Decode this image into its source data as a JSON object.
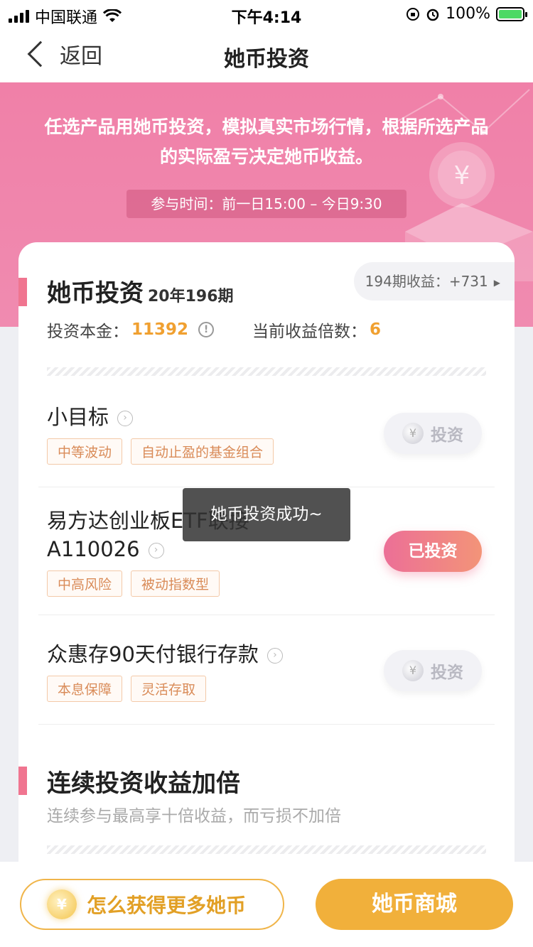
{
  "status_bar": {
    "carrier": "中国联通",
    "time": "下午4:14",
    "battery": "100%"
  },
  "nav": {
    "back_label": "返回",
    "title": "她币投资"
  },
  "banner": {
    "text": "任选产品用她币投资，模拟真实市场行情，根据所选产品的实际盈亏决定她币收益。",
    "time_range": "参与时间：前一日15:00 – 今日9:30",
    "coin_symbol": "¥"
  },
  "investment": {
    "title": "她币投资",
    "issue": "20年196期",
    "last_earnings": "194期收益：+731",
    "principal_label": "投资本金：",
    "principal_value": "11392",
    "multiplier_label": "当前收益倍数：",
    "multiplier_value": "6"
  },
  "products": [
    {
      "name": "小目标",
      "tags": [
        "中等波动",
        "自动止盈的基金组合"
      ],
      "action": "投资",
      "invested": false
    },
    {
      "name_line1": "易方达创业板ETF联接",
      "name_line2": "A110026",
      "tags": [
        "中高风险",
        "被动指数型"
      ],
      "action": "已投资",
      "invested": true
    },
    {
      "name": "众惠存90天付银行存款",
      "tags": [
        "本息保障",
        "灵活存取"
      ],
      "action": "投资",
      "invested": false
    }
  ],
  "bonus": {
    "title": "连续投资收益加倍",
    "subtitle": "连续参与最高享十倍收益，而亏损不加倍"
  },
  "toast": "她币投资成功~",
  "bottom": {
    "more_coins_label": "怎么获得更多她币",
    "mall_label": "她币商城",
    "coin_symbol": "¥"
  },
  "colors": {
    "banner_pink": "#f080a8",
    "accent_gold": "#f1b03b",
    "highlight_orange": "#f0a030",
    "invested_gradient": [
      "#ec6f97",
      "#f39478"
    ]
  }
}
